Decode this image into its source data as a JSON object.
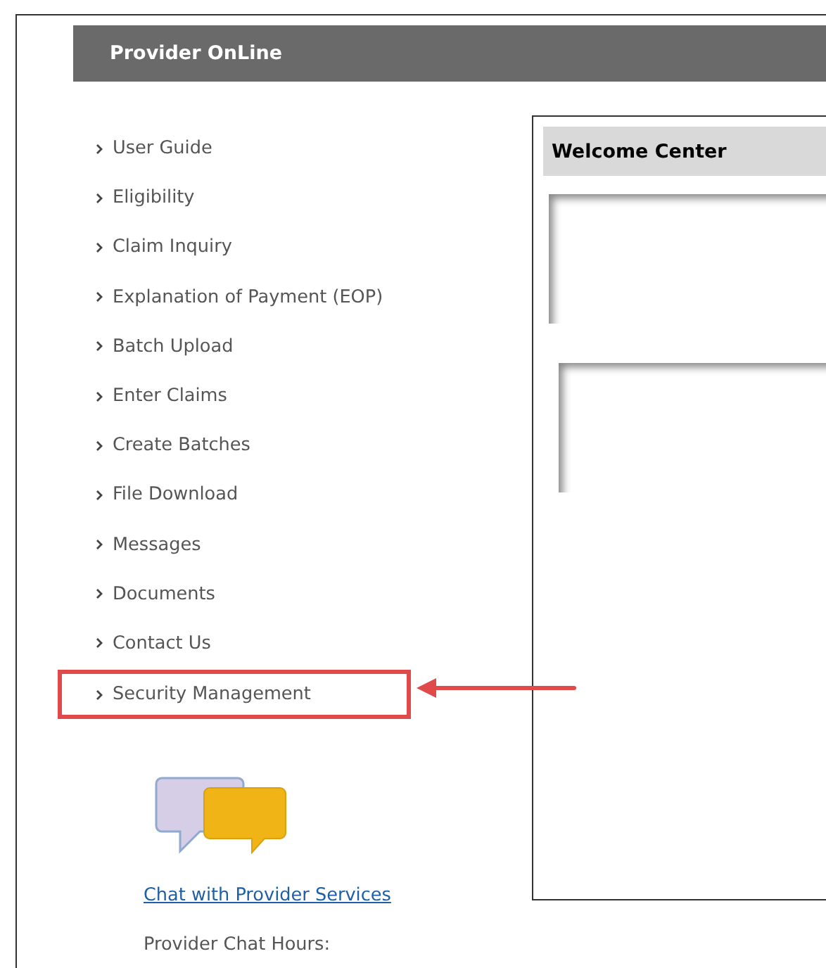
{
  "header": {
    "title": "Provider OnLine"
  },
  "nav": {
    "items": [
      {
        "label": "User Guide",
        "highlighted": false
      },
      {
        "label": "Eligibility",
        "highlighted": false
      },
      {
        "label": "Claim Inquiry",
        "highlighted": false
      },
      {
        "label": "Explanation of Payment (EOP)",
        "highlighted": false
      },
      {
        "label": "Batch Upload",
        "highlighted": false
      },
      {
        "label": "Enter Claims",
        "highlighted": false
      },
      {
        "label": "Create Batches",
        "highlighted": false
      },
      {
        "label": "File Download",
        "highlighted": false
      },
      {
        "label": "Messages",
        "highlighted": false
      },
      {
        "label": "Documents",
        "highlighted": false
      },
      {
        "label": "Contact Us",
        "highlighted": false
      },
      {
        "label": "Security Management",
        "highlighted": true
      }
    ]
  },
  "chat": {
    "link": "Chat with Provider Services",
    "hours_label": "Provider Chat Hours:"
  },
  "welcome": {
    "title": "Welcome Center"
  }
}
